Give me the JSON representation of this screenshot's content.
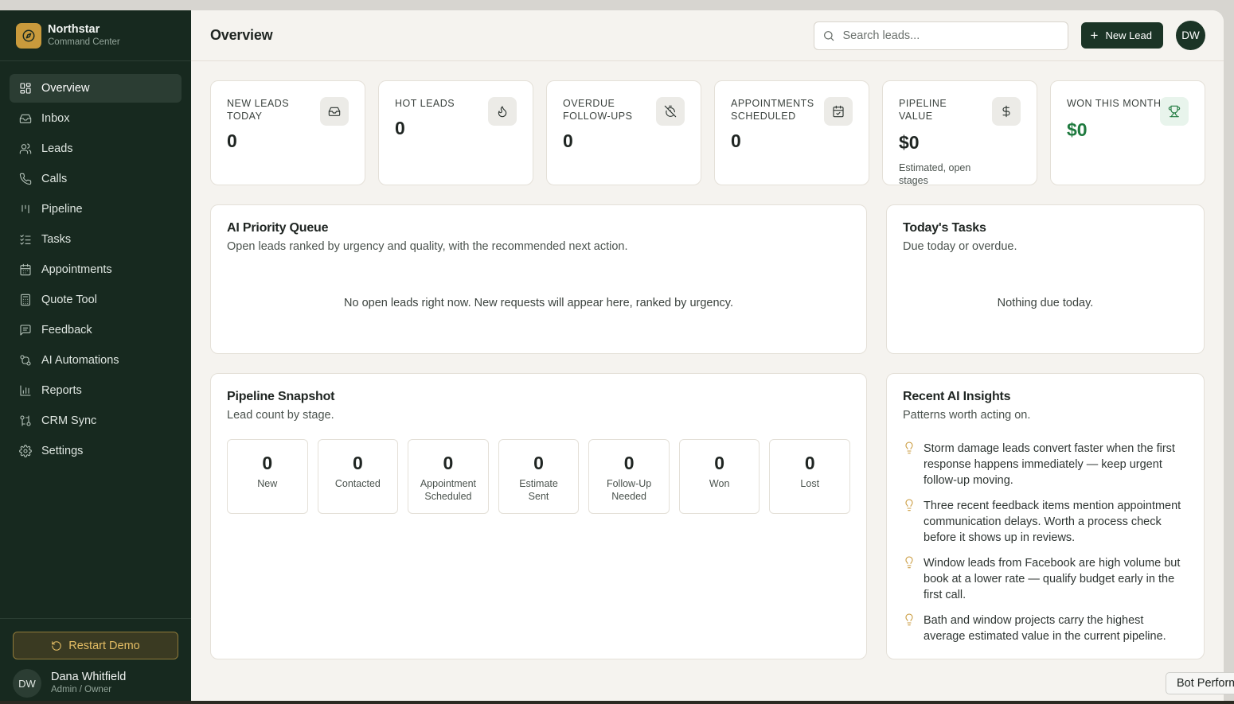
{
  "brand": {
    "name": "Northstar",
    "subtitle": "Command Center",
    "icon": "compass-icon",
    "accent": "#c99a3c"
  },
  "sidebar": {
    "items": [
      {
        "label": "Overview",
        "icon": "dashboard-icon",
        "active": true
      },
      {
        "label": "Inbox",
        "icon": "inbox-icon"
      },
      {
        "label": "Leads",
        "icon": "users-icon"
      },
      {
        "label": "Calls",
        "icon": "phone-icon"
      },
      {
        "label": "Pipeline",
        "icon": "kanban-icon"
      },
      {
        "label": "Tasks",
        "icon": "checklist-icon"
      },
      {
        "label": "Appointments",
        "icon": "calendar-icon"
      },
      {
        "label": "Quote Tool",
        "icon": "calculator-icon"
      },
      {
        "label": "Feedback",
        "icon": "message-icon"
      },
      {
        "label": "AI Automations",
        "icon": "workflow-icon"
      },
      {
        "label": "Reports",
        "icon": "bar-chart-icon"
      },
      {
        "label": "CRM Sync",
        "icon": "sync-icon"
      },
      {
        "label": "Settings",
        "icon": "gear-icon"
      }
    ],
    "restart_label": "Restart Demo",
    "user": {
      "initials": "DW",
      "name": "Dana Whitfield",
      "role": "Admin / Owner"
    }
  },
  "header": {
    "title": "Overview",
    "search_placeholder": "Search leads...",
    "new_lead_label": "New Lead",
    "avatar_initials": "DW"
  },
  "kpis": [
    {
      "label": "New Leads Today",
      "value": "0",
      "icon": "inbox-icon"
    },
    {
      "label": "Hot Leads",
      "value": "0",
      "icon": "flame-icon"
    },
    {
      "label": "Overdue Follow-Ups",
      "value": "0",
      "icon": "timer-off-icon"
    },
    {
      "label": "Appointments Scheduled",
      "value": "0",
      "icon": "calendar-check-icon"
    },
    {
      "label": "Pipeline Value",
      "value": "$0",
      "note": "Estimated, open stages",
      "icon": "dollar-icon"
    },
    {
      "label": "Won This Month",
      "value": "$0",
      "icon": "trophy-icon",
      "color": "#1f7a3f"
    }
  ],
  "priority_queue": {
    "title": "AI Priority Queue",
    "subtitle": "Open leads ranked by urgency and quality, with the recommended next action.",
    "empty": "No open leads right now. New requests will appear here, ranked by urgency."
  },
  "tasks": {
    "title": "Today's Tasks",
    "subtitle": "Due today or overdue.",
    "empty": "Nothing due today."
  },
  "pipeline": {
    "title": "Pipeline Snapshot",
    "subtitle": "Lead count by stage.",
    "stages": [
      {
        "count": "0",
        "label": "New"
      },
      {
        "count": "0",
        "label": "Contacted"
      },
      {
        "count": "0",
        "label": "Appointment Scheduled"
      },
      {
        "count": "0",
        "label": "Estimate Sent"
      },
      {
        "count": "0",
        "label": "Follow-Up Needed"
      },
      {
        "count": "0",
        "label": "Won"
      },
      {
        "count": "0",
        "label": "Lost"
      }
    ]
  },
  "insights": {
    "title": "Recent AI Insights",
    "subtitle": "Patterns worth acting on.",
    "items": [
      "Storm damage leads convert faster when the first response happens immediately — keep urgent follow-up moving.",
      "Three recent feedback items mention appointment communication delays. Worth a process check before it shows up in reviews.",
      "Window leads from Facebook are high volume but book at a lower rate — qualify budget early in the first call.",
      "Bath and window projects carry the highest average estimated value in the current pipeline."
    ]
  },
  "bot_button_label": "Bot Perform"
}
